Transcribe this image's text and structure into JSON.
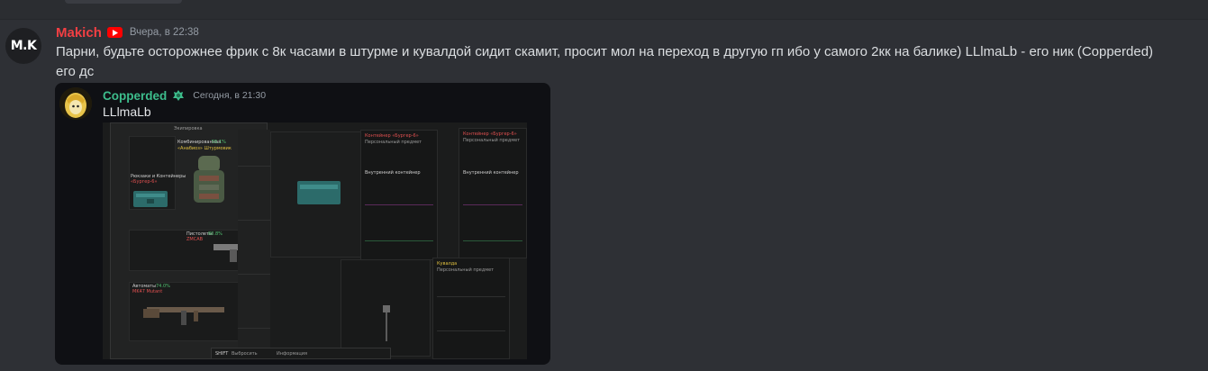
{
  "message": {
    "username": "Makich",
    "badge_icon": "youtube-icon",
    "timestamp": "Вчера, в 22:38",
    "avatar_text": "M.K",
    "text_line1": "Парни, будьте осторожнее фрик с 8к часами в штурме и кувалдой сидит скамит, просит мол на переход в другую гп ибо у самого 2кк на балике) LLlmaLb - его ник (Copperded)",
    "text_line2": "его дс"
  },
  "embed": {
    "username": "Copperded",
    "badge_icon": "green-badge-icon",
    "timestamp": "Сегодня, в 21:30",
    "text": "LLlmaLb",
    "screenshot": {
      "equipment_title": "Экипировка",
      "armor_label": "Комбинированная",
      "armor_pct": "55.1%",
      "armor_name": "«Анабиоз» Штурмовик",
      "container_label": "Рюкзаки и Контейнеры",
      "container_name": "«Бургер-6»",
      "pistol_label": "Пистолеты",
      "pistol_pct": "80.8%",
      "pistol_name": "ZMCAB",
      "weapon_label": "Автоматы",
      "weapon_pct": "74.0%",
      "weapon_name": "MK47 Mutant",
      "popup1_title": "Контейнер «Бургер-6»",
      "popup2_title": "Контейнер «Бургер-6»",
      "popup3_title": "Кувалда",
      "popup_subtitle": "Персональный предмет",
      "container_section": "Внутренний контейнер",
      "footer_key1": "SHIFT",
      "footer_action1": "Выбросить",
      "footer_action2": "Информация"
    }
  }
}
